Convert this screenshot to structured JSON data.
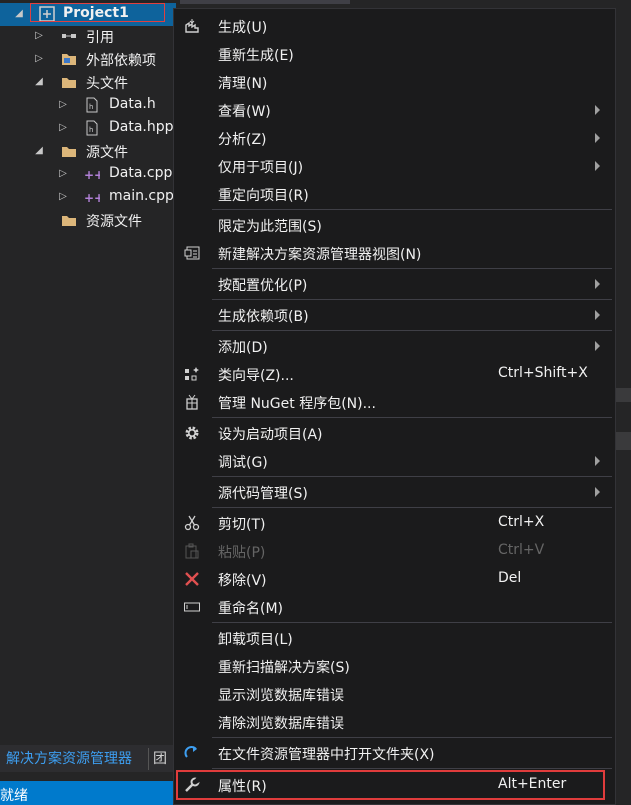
{
  "tree": {
    "items": [
      {
        "label": "Project1",
        "icon": "project-icon"
      },
      {
        "label": "引用",
        "icon": "references-icon"
      },
      {
        "label": "外部依赖项",
        "icon": "folder-icon"
      },
      {
        "label": "头文件",
        "icon": "folder-icon"
      },
      {
        "label": "Data.h",
        "icon": "header-file-icon"
      },
      {
        "label": "Data.hpp",
        "icon": "header-file-icon"
      },
      {
        "label": "源文件",
        "icon": "folder-icon"
      },
      {
        "label": "Data.cpp",
        "icon": "cpp-file-icon"
      },
      {
        "label": "main.cpp",
        "icon": "cpp-file-icon"
      },
      {
        "label": "资源文件",
        "icon": "folder-icon"
      }
    ]
  },
  "menu": {
    "items": [
      {
        "label": "生成(U)",
        "icon": "build-icon"
      },
      {
        "label": "重新生成(E)"
      },
      {
        "label": "清理(N)"
      },
      {
        "label": "查看(W)",
        "submenu": true
      },
      {
        "label": "分析(Z)",
        "submenu": true
      },
      {
        "label": "仅用于项目(J)",
        "submenu": true
      },
      {
        "label": "重定向项目(R)"
      },
      {
        "label": "限定为此范围(S)"
      },
      {
        "label": "新建解决方案资源管理器视图(N)",
        "icon": "new-view-icon"
      },
      {
        "label": "按配置优化(P)",
        "submenu": true
      },
      {
        "label": "生成依赖项(B)",
        "submenu": true
      },
      {
        "label": "添加(D)",
        "submenu": true
      },
      {
        "label": "类向导(Z)...",
        "shortcut": "Ctrl+Shift+X",
        "icon": "class-wizard-icon"
      },
      {
        "label": "管理 NuGet 程序包(N)...",
        "icon": "nuget-icon"
      },
      {
        "label": "设为启动项目(A)",
        "icon": "gear-icon"
      },
      {
        "label": "调试(G)",
        "submenu": true
      },
      {
        "label": "源代码管理(S)",
        "submenu": true
      },
      {
        "label": "剪切(T)",
        "shortcut": "Ctrl+X",
        "icon": "scissors-icon"
      },
      {
        "label": "粘贴(P)",
        "shortcut": "Ctrl+V",
        "icon": "paste-icon",
        "disabled": true
      },
      {
        "label": "移除(V)",
        "shortcut": "Del",
        "icon": "remove-icon"
      },
      {
        "label": "重命名(M)",
        "icon": "rename-icon"
      },
      {
        "label": "卸载项目(L)"
      },
      {
        "label": "重新扫描解决方案(S)"
      },
      {
        "label": "显示浏览数据库错误"
      },
      {
        "label": "清除浏览数据库错误"
      },
      {
        "label": "在文件资源管理器中打开文件夹(X)",
        "icon": "open-folder-arrow-icon"
      },
      {
        "label": "属性(R)",
        "shortcut": "Alt+Enter",
        "icon": "wrench-icon"
      }
    ]
  },
  "bottom": {
    "tab_solution_explorer": "解决方案资源管理器",
    "tab_team": "团",
    "status": "就绪"
  },
  "colors": {
    "selection": "#0e639c",
    "status_bar": "#007acc",
    "highlight_box": "#e03c3c",
    "folder": "#dcb67a",
    "cpp_icon": "#b180d7"
  }
}
